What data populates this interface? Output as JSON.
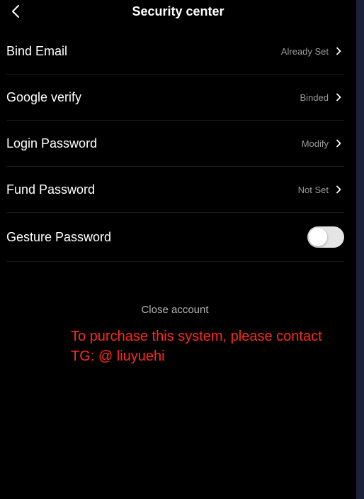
{
  "header": {
    "title": "Security center",
    "back_icon": "chevron-left-icon"
  },
  "rows": [
    {
      "label": "Bind Email",
      "status": "Already Set",
      "icon": "chevron-right-icon"
    },
    {
      "label": "Google verify",
      "status": "Binded",
      "icon": "chevron-right-icon"
    },
    {
      "label": "Login Password",
      "status": "Modify",
      "icon": "chevron-right-icon"
    },
    {
      "label": "Fund Password",
      "status": "Not Set",
      "icon": "chevron-right-icon"
    }
  ],
  "gesture": {
    "label": "Gesture Password",
    "enabled": false
  },
  "close_account": "Close account",
  "watermark": {
    "line1": "To purchase this system, please contact",
    "line2": "TG: @ liuyuehi",
    "color": "#ff2a1f"
  },
  "colors": {
    "background": "#000000",
    "text": "#ffffff",
    "muted": "#9a9a9a",
    "divider": "#1c1c1c"
  }
}
